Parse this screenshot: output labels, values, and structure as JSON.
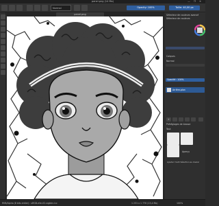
{
  "window": {
    "title": "panel.png (14 Mo)",
    "controls": "— ❐ ✕"
  },
  "toolbar": {
    "mode_select": "Normal",
    "opacity_label": "Opacity: 100%",
    "size_label": "Taille: 40,00 px"
  },
  "document": {
    "tab_label": "panel.png"
  },
  "right_panel": {
    "color_selector_label": "Sélecteur de couleurs avancé",
    "color_wheel_label": "Sélecteur de couleurs",
    "layers_label": "Calques",
    "blend_mode": "Normal",
    "opacity_bar": "Opacité : 100%",
    "layer_name": "Arrière-plan",
    "brush_presets_label": "Préréglages de brosse",
    "tags_label": "Tout",
    "overview_label": "Aperçu",
    "hint_text": "Ajouter l'outil Sélection au clavier"
  },
  "statusbar": {
    "left": "RVB/Alpha (8 bits entier) : sRGB-elle-V2-srgbtrc.icc",
    "center": "1 231 x 1 770 (13,4 Mo)",
    "zoom": "100%"
  },
  "colors": {
    "accent": "#2f5f9f",
    "panel": "#2f2f2f",
    "hair": "#3d3d3d",
    "skin": "#a9a9a9"
  }
}
